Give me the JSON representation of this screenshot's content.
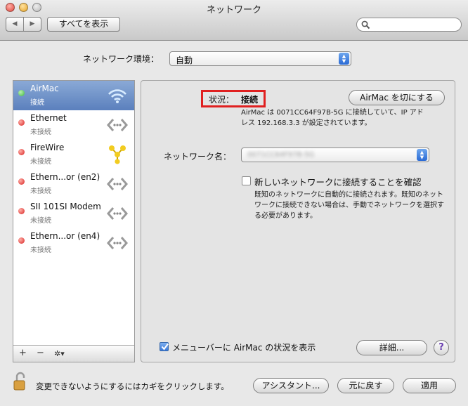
{
  "window": {
    "title": "ネットワーク"
  },
  "toolbar": {
    "show_all": "すべてを表示",
    "back": "◀",
    "forward": "▶"
  },
  "location": {
    "label": "ネットワーク環境：",
    "value": "自動"
  },
  "sidebar": {
    "items": [
      {
        "name": "AirMac",
        "status": "接続",
        "status_color": "#3fb83f",
        "icon": "wifi-icon"
      },
      {
        "name": "Ethernet",
        "status": "未接続",
        "status_color": "#d82020",
        "icon": "ethernet-icon"
      },
      {
        "name": "FireWire",
        "status": "未接続",
        "status_color": "#d82020",
        "icon": "firewire-icon"
      },
      {
        "name": "Ethern...or (en2)",
        "status": "未接続",
        "status_color": "#d82020",
        "icon": "ethernet-icon"
      },
      {
        "name": "SII 101SI Modem",
        "status": "未接続",
        "status_color": "#d82020",
        "icon": "modem-icon"
      },
      {
        "name": "Ethern...or (en4)",
        "status": "未接続",
        "status_color": "#d82020",
        "icon": "ethernet-icon"
      }
    ],
    "add": "+",
    "remove": "−",
    "action": "✲▾"
  },
  "detail": {
    "status_label": "状況：",
    "status_value": "接続",
    "airmac_off_button": "AirMac を切にする",
    "status_desc_1": "AirMac は 0071CC64F97B-5G に接続していて、IP アド",
    "status_desc_2": "レス 192.168.3.3 が設定されています。",
    "network_name_label": "ネットワーク名：",
    "network_name_value": "0071CC64F97B-5G",
    "confirm_label": "新しいネットワークに接続することを確認",
    "confirm_desc_1": "既知のネットワークに自動的に接続されます。既知のネット",
    "confirm_desc_2": "ワークに接続できない場合は、手動でネットワークを選択す",
    "confirm_desc_3": "る必要があります。",
    "menubar_label": "メニューバーに AirMac の状況を表示",
    "advanced_button": "詳細...",
    "help_button": "?"
  },
  "footer": {
    "lock_text": "変更できないようにするにはカギをクリックします。",
    "assistant_button": "アシスタント...",
    "revert_button": "元に戻す",
    "apply_button": "適用"
  },
  "colors": {
    "highlight_box": "#e02020",
    "selection": "#6a8cc7"
  }
}
